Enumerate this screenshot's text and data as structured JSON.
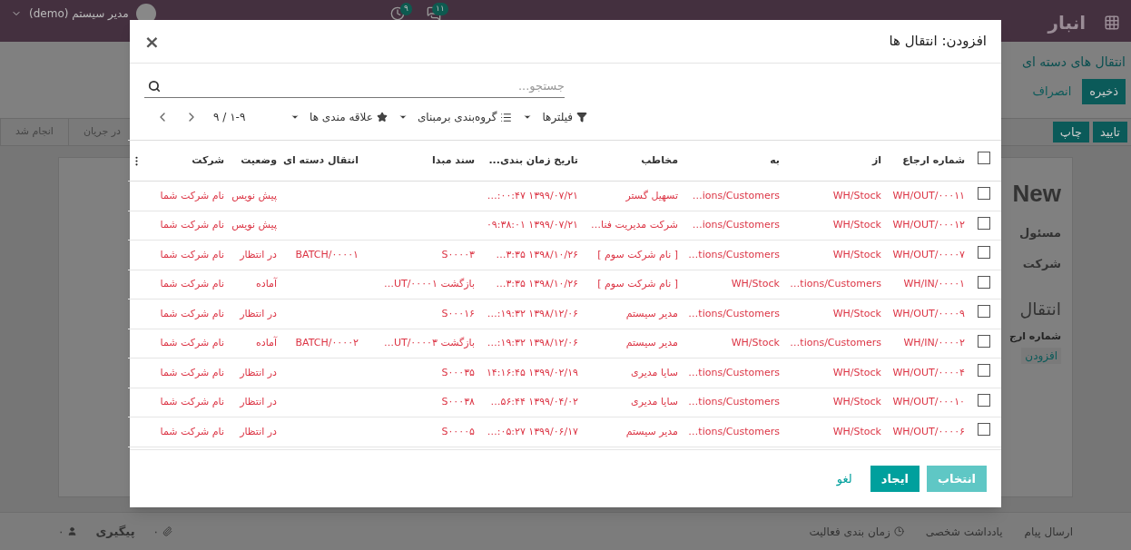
{
  "navbar": {
    "app": "انبار",
    "badges": [
      {
        "kind": "chat",
        "count": "۱۱"
      },
      {
        "kind": "clock",
        "count": "۹"
      }
    ],
    "user": "مدیر سیستم (demo)"
  },
  "control_panel": {
    "breadcrumb": "انتقال های دسته ای",
    "save": "ذخیره",
    "discard": "انصراف"
  },
  "header_buttons": [
    "تایید",
    "چاپ"
  ],
  "statusbar": [
    "در جریان",
    "انجام شد"
  ],
  "sheet": {
    "title": "New",
    "fields": [
      "مسئول",
      "شرکت"
    ],
    "section": "انتقال",
    "column": "شماره ارج",
    "add_line": "افزودن"
  },
  "dialog": {
    "title": "افزودن: انتقال ها",
    "close": "×",
    "search": {
      "placeholder": "جستجو..."
    },
    "filters": [
      {
        "kind": "filter",
        "label": "فیلترها"
      },
      {
        "kind": "group",
        "label": "گروه‌بندی برمبنای"
      },
      {
        "kind": "favorite",
        "label": "علاقه مندی ها"
      }
    ],
    "pager": "۱-۹ / ۹",
    "select_all": {
      "checked": false
    },
    "columns": [
      "شماره ارجاع",
      "از",
      "به",
      "مخاطب",
      "تاریخ زمان بندی...",
      "سند مبدا",
      "انتقال دسته ای",
      "وضعیت",
      "شرکت"
    ],
    "rows": [
      {
        "checked": false,
        "reference": "WH/OUT/۰۰۰۱۱",
        "source": "WH/Stock",
        "destination": "…ions/Customers",
        "partner": "تسهیل گستر",
        "scheduled": "…:۰۰:۴۷ ۱۳۹۹/۰۷/۲۱",
        "status": "پیش نویس",
        "company": "نام شرکت شما"
      },
      {
        "checked": false,
        "reference": "WH/OUT/۰۰۰۱۲",
        "source": "WH/Stock",
        "destination": "…ions/Customers",
        "partner": "شرکت مدیریت فنا…",
        "scheduled": "۰۹:۳۸:۰۱ ۱۳۹۹/۰۷/۲۱",
        "status": "پیش نویس",
        "company": "نام شرکت شما"
      },
      {
        "checked": false,
        "reference": "WH/OUT/۰۰۰۰۷",
        "source": "WH/Stock",
        "destination": "…tions/Customers",
        "partner": "[ نام شرکت سوم ]",
        "scheduled": "…۳:۳۵ ۱۳۹۸/۱۰/۲۶",
        "origin": "S۰۰۰۰۳",
        "batch": "BATCH/۰۰۰۰۱",
        "status": "در انتظار",
        "company": "نام شرکت شما"
      },
      {
        "checked": false,
        "reference": "WH/IN/۰۰۰۰۱",
        "source": "…tions/Customers",
        "destination": "WH/Stock",
        "partner": "[ نام شرکت سوم ]",
        "scheduled": "…۳:۳۵ ۱۳۹۸/۱۰/۲۶",
        "origin": "بازگشت UT/۰۰۰۰۱…",
        "status": "آماده",
        "company": "نام شرکت شما"
      },
      {
        "checked": false,
        "reference": "WH/OUT/۰۰۰۰۹",
        "source": "WH/Stock",
        "destination": "…tions/Customers",
        "partner": "مدیر سیستم",
        "scheduled": "…:۱۹:۳۲ ۱۳۹۸/۱۲/۰۶",
        "origin": "S۰۰۰۱۶",
        "status": "در انتظار",
        "company": "نام شرکت شما"
      },
      {
        "checked": false,
        "reference": "WH/IN/۰۰۰۰۲",
        "source": "…tions/Customers",
        "destination": "WH/Stock",
        "partner": "مدیر سیستم",
        "scheduled": "…:۱۹:۳۲ ۱۳۹۸/۱۲/۰۶",
        "origin": "بازگشت UT/۰۰۰۰۳…",
        "batch": "BATCH/۰۰۰۰۲",
        "status": "آماده",
        "company": "نام شرکت شما"
      },
      {
        "checked": false,
        "reference": "WH/OUT/۰۰۰۰۴",
        "source": "WH/Stock",
        "destination": "…tions/Customers",
        "partner": "سایا مدیری",
        "scheduled": "۱۴:۱۶:۴۵ ۱۳۹۹/۰۲/۱۹",
        "origin": "S۰۰۰۳۵",
        "status": "در انتظار",
        "company": "نام شرکت شما"
      },
      {
        "checked": false,
        "reference": "WH/OUT/۰۰۰۱۰",
        "source": "WH/Stock",
        "destination": "…tions/Customers",
        "partner": "سایا مدیری",
        "scheduled": "…۵۶:۴۴ ۱۳۹۹/۰۴/۰۲",
        "origin": "S۰۰۰۳۸",
        "status": "در انتظار",
        "company": "نام شرکت شما"
      },
      {
        "checked": false,
        "reference": "WH/OUT/۰۰۰۰۶",
        "source": "WH/Stock",
        "destination": "…tions/Customers",
        "partner": "مدیر سیستم",
        "scheduled": "…:۰۵:۲۷ ۱۳۹۹/۰۶/۱۷",
        "origin": "S۰۰۰۰۵",
        "status": "در انتظار",
        "company": "نام شرکت شما"
      }
    ],
    "buttons": [
      {
        "kind": "primary",
        "label": "انتخاب",
        "disabled": true
      },
      {
        "kind": "primary",
        "label": "ایجاد",
        "disabled": false
      },
      {
        "kind": "link",
        "label": "لغو",
        "disabled": false
      }
    ]
  },
  "chatter": {
    "send_message": "ارسال پیام",
    "log_note": "یادداشت شخصی",
    "schedule": "زمان بندی فعالیت",
    "attachments": "۰",
    "follow": "پیگیری",
    "followers": "۰"
  }
}
